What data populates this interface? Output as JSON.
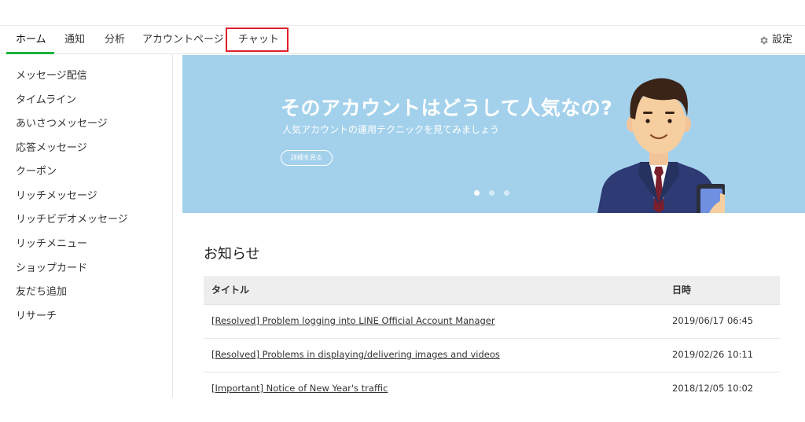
{
  "nav": {
    "tabs": [
      {
        "label": "ホーム",
        "active": true
      },
      {
        "label": "通知"
      },
      {
        "label": "分析"
      },
      {
        "label": "アカウントページ"
      },
      {
        "label": "チャット",
        "highlighted": true
      }
    ],
    "settings_label": "設定"
  },
  "sidebar": {
    "items": [
      {
        "label": "メッセージ配信"
      },
      {
        "label": "タイムライン"
      },
      {
        "label": "あいさつメッセージ"
      },
      {
        "label": "応答メッセージ"
      },
      {
        "label": "クーポン"
      },
      {
        "label": "リッチメッセージ"
      },
      {
        "label": "リッチビデオメッセージ"
      },
      {
        "label": "リッチメニュー"
      },
      {
        "label": "ショップカード"
      },
      {
        "label": "友だち追加"
      },
      {
        "label": "リサーチ"
      }
    ]
  },
  "banner": {
    "title": "そのアカウントはどうして人気なの?",
    "subtitle": "人気アカウントの運用テクニックを見てみましょう",
    "button_label": "詳細を見る",
    "slide_count": 3,
    "active_slide": 1
  },
  "news": {
    "heading": "お知らせ",
    "columns": {
      "title": "タイトル",
      "date": "日時"
    },
    "rows": [
      {
        "title": "[Resolved] Problem logging into LINE Official Account Manager",
        "date": "2019/06/17 06:45"
      },
      {
        "title": "[Resolved] Problems in displaying/delivering images and videos",
        "date": "2019/02/26 10:11"
      },
      {
        "title": "[Important] Notice of New Year's traffic",
        "date": "2018/12/05 10:02"
      }
    ]
  },
  "colors": {
    "accent_green": "#19b33c",
    "highlight_red": "#e01e2a",
    "banner_blue": "#a3d1ec"
  },
  "icons": {
    "settings": "gear-icon"
  }
}
